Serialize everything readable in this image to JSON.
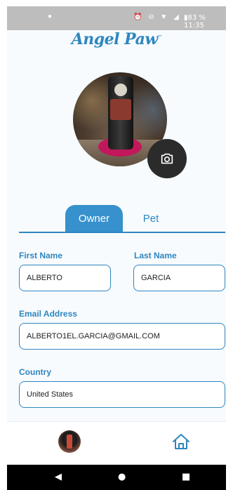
{
  "status_bar": {
    "message_icon": "chat-bubble-icon",
    "battery_percent": "83 %",
    "time": "11:35"
  },
  "app": {
    "brand": "Angel Paw",
    "brand_mark": "™",
    "accent": "#2f86bf"
  },
  "profile": {
    "photo_description_icon": "profile-photo",
    "camera_icon": "camera-icon"
  },
  "tabs": [
    {
      "label": "Owner",
      "active": true
    },
    {
      "label": "Pet",
      "active": false
    }
  ],
  "form": {
    "first_name": {
      "label": "First Name",
      "value": "ALBERTO"
    },
    "last_name": {
      "label": "Last Name",
      "value": "GARCIA"
    },
    "email": {
      "label": "Email Address",
      "value": "ALBERTO1EL.GARCIA@GMAIL.COM"
    },
    "country": {
      "label": "Country",
      "value": "United States"
    }
  },
  "bottom_nav": {
    "items": [
      "avatar",
      "home-icon"
    ]
  },
  "android_nav": {
    "back": "◀",
    "home": "●",
    "recents": "■"
  }
}
